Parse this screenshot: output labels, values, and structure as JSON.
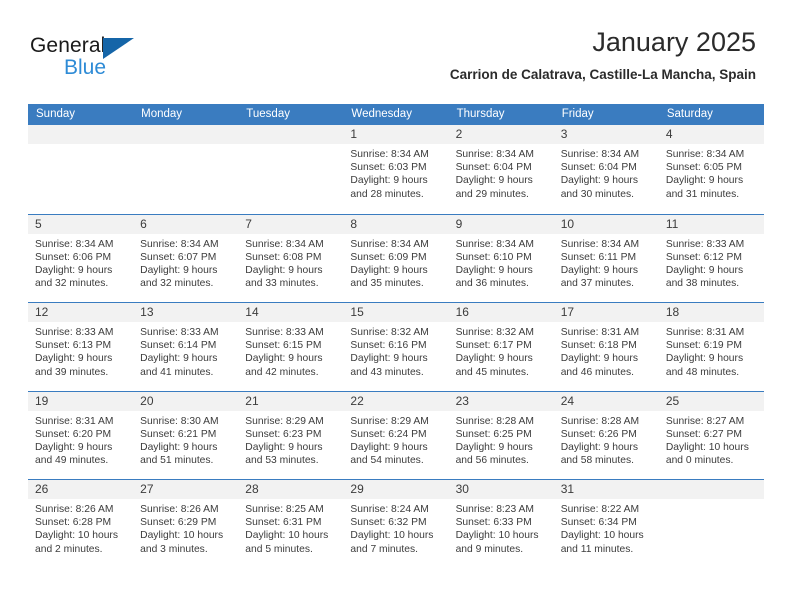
{
  "brand": {
    "name_part1": "General",
    "name_part2": "Blue",
    "triangle_color": "#1565a8",
    "blue_color": "#2e8bd6"
  },
  "header": {
    "title": "January 2025",
    "subtitle": "Carrion de Calatrava, Castille-La Mancha, Spain"
  },
  "theme": {
    "header_blue": "#3a7cc0",
    "day_band_gray": "#f2f2f2",
    "text_color": "#3c3c3c"
  },
  "weekdays": [
    "Sunday",
    "Monday",
    "Tuesday",
    "Wednesday",
    "Thursday",
    "Friday",
    "Saturday"
  ],
  "weeks": [
    [
      {
        "day": "",
        "sunrise": "",
        "sunset": "",
        "daylight_line1": "",
        "daylight_line2": ""
      },
      {
        "day": "",
        "sunrise": "",
        "sunset": "",
        "daylight_line1": "",
        "daylight_line2": ""
      },
      {
        "day": "",
        "sunrise": "",
        "sunset": "",
        "daylight_line1": "",
        "daylight_line2": ""
      },
      {
        "day": "1",
        "sunrise": "Sunrise: 8:34 AM",
        "sunset": "Sunset: 6:03 PM",
        "daylight_line1": "Daylight: 9 hours",
        "daylight_line2": "and 28 minutes."
      },
      {
        "day": "2",
        "sunrise": "Sunrise: 8:34 AM",
        "sunset": "Sunset: 6:04 PM",
        "daylight_line1": "Daylight: 9 hours",
        "daylight_line2": "and 29 minutes."
      },
      {
        "day": "3",
        "sunrise": "Sunrise: 8:34 AM",
        "sunset": "Sunset: 6:04 PM",
        "daylight_line1": "Daylight: 9 hours",
        "daylight_line2": "and 30 minutes."
      },
      {
        "day": "4",
        "sunrise": "Sunrise: 8:34 AM",
        "sunset": "Sunset: 6:05 PM",
        "daylight_line1": "Daylight: 9 hours",
        "daylight_line2": "and 31 minutes."
      }
    ],
    [
      {
        "day": "5",
        "sunrise": "Sunrise: 8:34 AM",
        "sunset": "Sunset: 6:06 PM",
        "daylight_line1": "Daylight: 9 hours",
        "daylight_line2": "and 32 minutes."
      },
      {
        "day": "6",
        "sunrise": "Sunrise: 8:34 AM",
        "sunset": "Sunset: 6:07 PM",
        "daylight_line1": "Daylight: 9 hours",
        "daylight_line2": "and 32 minutes."
      },
      {
        "day": "7",
        "sunrise": "Sunrise: 8:34 AM",
        "sunset": "Sunset: 6:08 PM",
        "daylight_line1": "Daylight: 9 hours",
        "daylight_line2": "and 33 minutes."
      },
      {
        "day": "8",
        "sunrise": "Sunrise: 8:34 AM",
        "sunset": "Sunset: 6:09 PM",
        "daylight_line1": "Daylight: 9 hours",
        "daylight_line2": "and 35 minutes."
      },
      {
        "day": "9",
        "sunrise": "Sunrise: 8:34 AM",
        "sunset": "Sunset: 6:10 PM",
        "daylight_line1": "Daylight: 9 hours",
        "daylight_line2": "and 36 minutes."
      },
      {
        "day": "10",
        "sunrise": "Sunrise: 8:34 AM",
        "sunset": "Sunset: 6:11 PM",
        "daylight_line1": "Daylight: 9 hours",
        "daylight_line2": "and 37 minutes."
      },
      {
        "day": "11",
        "sunrise": "Sunrise: 8:33 AM",
        "sunset": "Sunset: 6:12 PM",
        "daylight_line1": "Daylight: 9 hours",
        "daylight_line2": "and 38 minutes."
      }
    ],
    [
      {
        "day": "12",
        "sunrise": "Sunrise: 8:33 AM",
        "sunset": "Sunset: 6:13 PM",
        "daylight_line1": "Daylight: 9 hours",
        "daylight_line2": "and 39 minutes."
      },
      {
        "day": "13",
        "sunrise": "Sunrise: 8:33 AM",
        "sunset": "Sunset: 6:14 PM",
        "daylight_line1": "Daylight: 9 hours",
        "daylight_line2": "and 41 minutes."
      },
      {
        "day": "14",
        "sunrise": "Sunrise: 8:33 AM",
        "sunset": "Sunset: 6:15 PM",
        "daylight_line1": "Daylight: 9 hours",
        "daylight_line2": "and 42 minutes."
      },
      {
        "day": "15",
        "sunrise": "Sunrise: 8:32 AM",
        "sunset": "Sunset: 6:16 PM",
        "daylight_line1": "Daylight: 9 hours",
        "daylight_line2": "and 43 minutes."
      },
      {
        "day": "16",
        "sunrise": "Sunrise: 8:32 AM",
        "sunset": "Sunset: 6:17 PM",
        "daylight_line1": "Daylight: 9 hours",
        "daylight_line2": "and 45 minutes."
      },
      {
        "day": "17",
        "sunrise": "Sunrise: 8:31 AM",
        "sunset": "Sunset: 6:18 PM",
        "daylight_line1": "Daylight: 9 hours",
        "daylight_line2": "and 46 minutes."
      },
      {
        "day": "18",
        "sunrise": "Sunrise: 8:31 AM",
        "sunset": "Sunset: 6:19 PM",
        "daylight_line1": "Daylight: 9 hours",
        "daylight_line2": "and 48 minutes."
      }
    ],
    [
      {
        "day": "19",
        "sunrise": "Sunrise: 8:31 AM",
        "sunset": "Sunset: 6:20 PM",
        "daylight_line1": "Daylight: 9 hours",
        "daylight_line2": "and 49 minutes."
      },
      {
        "day": "20",
        "sunrise": "Sunrise: 8:30 AM",
        "sunset": "Sunset: 6:21 PM",
        "daylight_line1": "Daylight: 9 hours",
        "daylight_line2": "and 51 minutes."
      },
      {
        "day": "21",
        "sunrise": "Sunrise: 8:29 AM",
        "sunset": "Sunset: 6:23 PM",
        "daylight_line1": "Daylight: 9 hours",
        "daylight_line2": "and 53 minutes."
      },
      {
        "day": "22",
        "sunrise": "Sunrise: 8:29 AM",
        "sunset": "Sunset: 6:24 PM",
        "daylight_line1": "Daylight: 9 hours",
        "daylight_line2": "and 54 minutes."
      },
      {
        "day": "23",
        "sunrise": "Sunrise: 8:28 AM",
        "sunset": "Sunset: 6:25 PM",
        "daylight_line1": "Daylight: 9 hours",
        "daylight_line2": "and 56 minutes."
      },
      {
        "day": "24",
        "sunrise": "Sunrise: 8:28 AM",
        "sunset": "Sunset: 6:26 PM",
        "daylight_line1": "Daylight: 9 hours",
        "daylight_line2": "and 58 minutes."
      },
      {
        "day": "25",
        "sunrise": "Sunrise: 8:27 AM",
        "sunset": "Sunset: 6:27 PM",
        "daylight_line1": "Daylight: 10 hours",
        "daylight_line2": "and 0 minutes."
      }
    ],
    [
      {
        "day": "26",
        "sunrise": "Sunrise: 8:26 AM",
        "sunset": "Sunset: 6:28 PM",
        "daylight_line1": "Daylight: 10 hours",
        "daylight_line2": "and 2 minutes."
      },
      {
        "day": "27",
        "sunrise": "Sunrise: 8:26 AM",
        "sunset": "Sunset: 6:29 PM",
        "daylight_line1": "Daylight: 10 hours",
        "daylight_line2": "and 3 minutes."
      },
      {
        "day": "28",
        "sunrise": "Sunrise: 8:25 AM",
        "sunset": "Sunset: 6:31 PM",
        "daylight_line1": "Daylight: 10 hours",
        "daylight_line2": "and 5 minutes."
      },
      {
        "day": "29",
        "sunrise": "Sunrise: 8:24 AM",
        "sunset": "Sunset: 6:32 PM",
        "daylight_line1": "Daylight: 10 hours",
        "daylight_line2": "and 7 minutes."
      },
      {
        "day": "30",
        "sunrise": "Sunrise: 8:23 AM",
        "sunset": "Sunset: 6:33 PM",
        "daylight_line1": "Daylight: 10 hours",
        "daylight_line2": "and 9 minutes."
      },
      {
        "day": "31",
        "sunrise": "Sunrise: 8:22 AM",
        "sunset": "Sunset: 6:34 PM",
        "daylight_line1": "Daylight: 10 hours",
        "daylight_line2": "and 11 minutes."
      },
      {
        "day": "",
        "sunrise": "",
        "sunset": "",
        "daylight_line1": "",
        "daylight_line2": ""
      }
    ]
  ]
}
